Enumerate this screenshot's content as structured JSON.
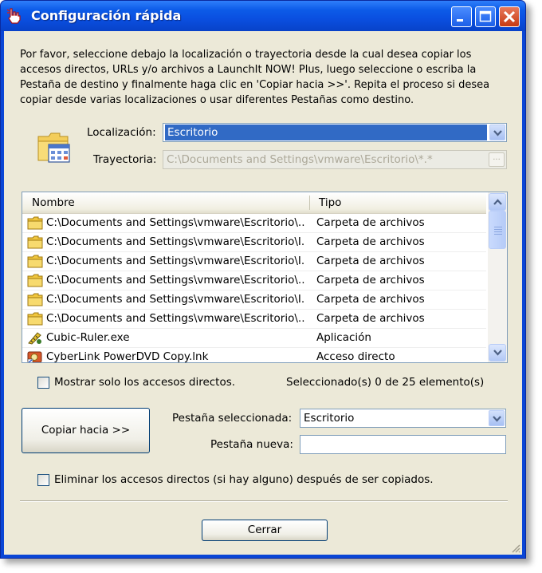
{
  "window": {
    "title": "Configuración rápida",
    "title_icon": "pointing-hand-icon",
    "minimize_icon": "minimize-icon",
    "maximize_icon": "maximize-icon",
    "close_icon": "close-icon"
  },
  "intro": {
    "line1": "Por favor, seleccione debajo la localización o trayectoria desde la cual desea copiar los",
    "line2": "accesos directos, URLs y/o archivos a LaunchIt NOW! Plus, luego seleccione o escriba la",
    "line3": "Pestaña de destino y finalmente haga clic en 'Copiar hacia >>'.  Repita el proceso si desea",
    "line4": "copiar desde varias localizaciones o usar diferentes Pestañas como destino."
  },
  "location": {
    "icon": "folder-with-grid-icon",
    "label": "Localización:",
    "value": "Escritorio"
  },
  "path": {
    "label": "Trayectoria:",
    "value": "C:\\Documents and Settings\\vmware\\Escritorio\\*.*",
    "browse_label": "..."
  },
  "list": {
    "columns": [
      "Nombre",
      "Tipo"
    ],
    "rows": [
      {
        "name": "C:\\Documents and Settings\\vmware\\Escritorio\\...",
        "type": "Carpeta de archivos",
        "icon": "folder-icon"
      },
      {
        "name": "C:\\Documents and Settings\\vmware\\Escritorio\\I...",
        "type": "Carpeta de archivos",
        "icon": "folder-icon"
      },
      {
        "name": "C:\\Documents and Settings\\vmware\\Escritorio\\I...",
        "type": "Carpeta de archivos",
        "icon": "folder-icon"
      },
      {
        "name": "C:\\Documents and Settings\\vmware\\Escritorio\\...",
        "type": "Carpeta de archivos",
        "icon": "folder-icon"
      },
      {
        "name": "C:\\Documents and Settings\\vmware\\Escritorio\\I...",
        "type": "Carpeta de archivos",
        "icon": "folder-icon"
      },
      {
        "name": "C:\\Documents and Settings\\vmware\\Escritorio\\...",
        "type": "Carpeta de archivos",
        "icon": "folder-icon"
      },
      {
        "name": "Cubic-Ruler.exe",
        "type": "Aplicación",
        "icon": "ruler-app-icon"
      },
      {
        "name": "CyberLink PowerDVD Copy.lnk",
        "type": "Acceso directo",
        "icon": "dvd-shortcut-icon"
      }
    ]
  },
  "show_shortcuts": {
    "label": "Mostrar solo los accesos directos.",
    "checked": false
  },
  "selection_status": "Seleccionado(s) 0 de 25 elemento(s)",
  "copy_button": "Copiar hacia >>",
  "selected_tab": {
    "label": "Pestaña seleccionada:",
    "value": "Escritorio"
  },
  "new_tab": {
    "label": "Pestaña nueva:",
    "value": ""
  },
  "delete_shortcuts": {
    "label": "Eliminar los accesos directos (si hay alguno) después de ser copiados.",
    "checked": false
  },
  "close_button": "Cerrar",
  "colors": {
    "titlebar": "#0a4fe0",
    "dialog_bg": "#ece9d8",
    "selection": "#316ac5"
  }
}
